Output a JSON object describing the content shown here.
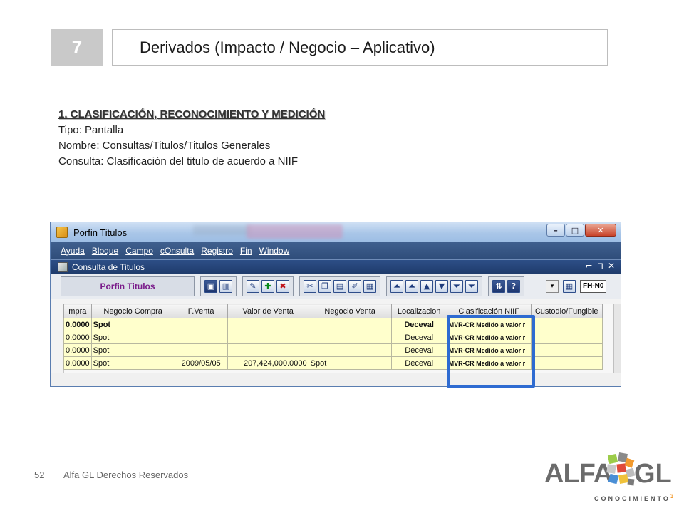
{
  "slide": {
    "number": "7",
    "title": "Derivados (Impacto / Negocio – Aplicativo)"
  },
  "section": {
    "heading": "1. CLASIFICACIÓN, RECONOCIMIENTO Y MEDICIÓN",
    "line1": "Tipo: Pantalla",
    "line2": "Nombre: Consultas/Titulos/Titulos Generales",
    "line3": "Consulta: Clasificación del titulo de acuerdo a NIIF"
  },
  "app": {
    "window_title": "Porfin Titulos",
    "window_controls": {
      "minimize": "–",
      "maximize": "□",
      "close": "✕"
    },
    "menu": [
      "Ayuda",
      "Bloque",
      "Campo",
      "cOnsulta",
      "Registro",
      "Fin",
      "Window"
    ],
    "inner_title": "Consulta de Titulos",
    "inner_controls": [
      "⌐",
      "⊓",
      "✕"
    ],
    "brand_label": "Porfin Titulos",
    "toolbar_field": "FH-N0",
    "toolbar_icons": {
      "group1": [
        "save-icon",
        "book-icon"
      ],
      "group2": [
        "edit-icon",
        "add-icon",
        "delete-icon"
      ],
      "group3": [
        "cut-icon",
        "copy-icon",
        "paste-icon",
        "edit-field-icon",
        "print-icon"
      ],
      "group4": [
        "first-record-icon",
        "prev-block-icon",
        "prev-record-icon",
        "next-record-icon",
        "next-block-icon",
        "last-record-icon"
      ],
      "group5": [
        "sort-icon",
        "help-icon"
      ]
    },
    "grid": {
      "columns": [
        "mpra",
        "Negocio Compra",
        "F.Venta",
        "Valor de Venta",
        "Negocio Venta",
        "Localizacion",
        "Clasificación NIIF",
        "Custodio/Fungible"
      ],
      "rows": [
        [
          "0.0000",
          "Spot",
          "",
          "",
          "",
          "Deceval",
          "MVR-CR",
          "Medido a valor r"
        ],
        [
          "0.0000",
          "Spot",
          "",
          "",
          "",
          "Deceval",
          "MVR-CR",
          "Medido a valor r"
        ],
        [
          "0.0000",
          "Spot",
          "",
          "",
          "",
          "Deceval",
          "MVR-CR",
          "Medido a valor r"
        ],
        [
          "0.0000",
          "Spot",
          "2009/05/05",
          "207,424,000.0000",
          "Spot",
          "Deceval",
          "MVR-CR",
          "Medido a valor r"
        ]
      ]
    }
  },
  "footer": {
    "page": "52",
    "text": "Alfa GL Derechos Reservados"
  },
  "logo": {
    "left": "ALFA",
    "right": "GL",
    "sub": "CONOCIMIENTO",
    "sup": "3"
  },
  "colors": {
    "highlight": "#2e6bd1",
    "grid_cell": "#ffffcc",
    "brand_text": "#7a1b8a"
  }
}
